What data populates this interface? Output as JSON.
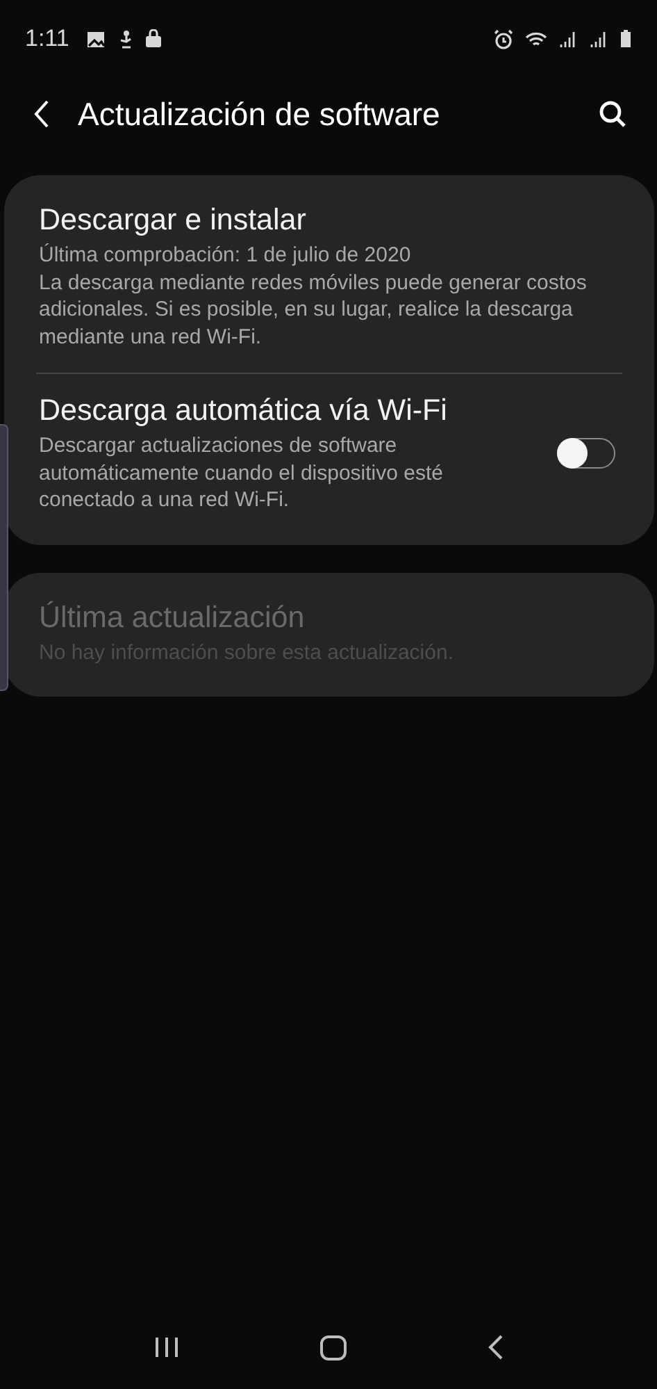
{
  "status_bar": {
    "time": "1:11"
  },
  "header": {
    "title": "Actualización de software"
  },
  "cards": [
    {
      "disabled": false,
      "items": [
        {
          "kind": "text",
          "title": "Descargar e instalar",
          "subtitle": "Última comprobación: 1 de julio de 2020\nLa descarga mediante redes móviles puede generar costos adicionales. Si es posible, en su lugar, realice la descarga mediante una red Wi-Fi."
        },
        {
          "kind": "toggle",
          "title": "Descarga automática vía Wi-Fi",
          "subtitle": "Descargar actualizaciones de software automáticamente cuando el dispositivo esté conectado a una red Wi-Fi.",
          "on": false
        }
      ]
    },
    {
      "disabled": true,
      "items": [
        {
          "kind": "text",
          "title": "Última actualización",
          "subtitle": "No hay información sobre esta actualización."
        }
      ]
    }
  ]
}
